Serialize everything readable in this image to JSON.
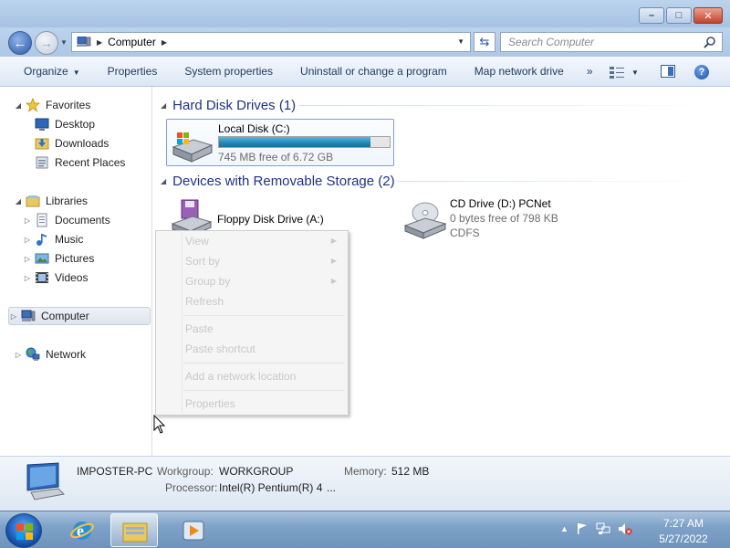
{
  "window": {
    "controls": {
      "minimize": "–",
      "maximize": "□",
      "close": "✕"
    }
  },
  "address": {
    "breadcrumb": "Computer",
    "search_placeholder": "Search Computer"
  },
  "toolbar": {
    "organize": "Organize",
    "properties": "Properties",
    "system_properties": "System properties",
    "uninstall": "Uninstall or change a program",
    "map_network": "Map network drive",
    "more": "»"
  },
  "nav": {
    "favorites": "Favorites",
    "desktop": "Desktop",
    "downloads": "Downloads",
    "recent_places": "Recent Places",
    "libraries": "Libraries",
    "documents": "Documents",
    "music": "Music",
    "pictures": "Pictures",
    "videos": "Videos",
    "computer": "Computer",
    "network": "Network"
  },
  "content": {
    "group_hdd": "Hard Disk Drives (1)",
    "group_removable": "Devices with Removable Storage (2)",
    "local_disk": {
      "name": "Local Disk (C:)",
      "free": "745 MB free of 6.72 GB",
      "used_fraction": 0.89
    },
    "floppy": {
      "name": "Floppy Disk Drive (A:)"
    },
    "cd": {
      "name": "CD Drive (D:) PCNet",
      "free": "0 bytes free of 798 KB",
      "fs": "CDFS"
    }
  },
  "context_menu": {
    "view": "View",
    "sort_by": "Sort by",
    "group_by": "Group by",
    "refresh": "Refresh",
    "paste": "Paste",
    "paste_shortcut": "Paste shortcut",
    "add_network_location": "Add a network location",
    "properties": "Properties"
  },
  "details": {
    "computer_name": "IMPOSTER-PC",
    "workgroup_label": "Workgroup:",
    "workgroup_value": "WORKGROUP",
    "memory_label": "Memory:",
    "memory_value": "512 MB",
    "processor_label": "Processor:",
    "processor_value": "Intel(R) Pentium(R) 4",
    "processor_more": "..."
  },
  "taskbar": {
    "time": "7:27 AM",
    "date": "5/27/2022"
  },
  "colors": {
    "group_header": "#1e3287",
    "progress": "#2584b3",
    "accent": "#3a6fb5"
  }
}
